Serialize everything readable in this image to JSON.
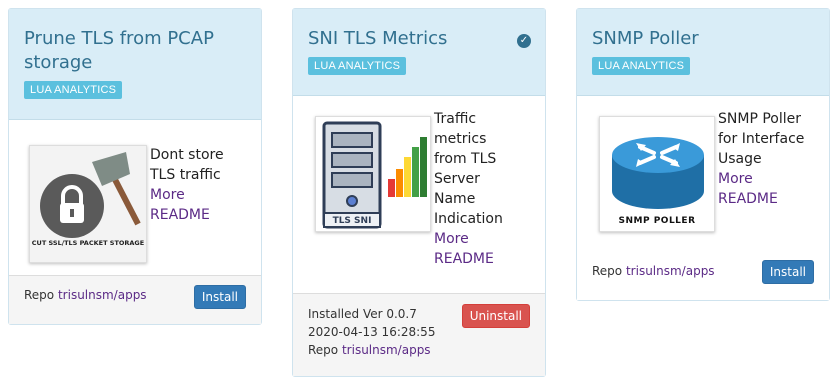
{
  "colors": {
    "header_bg": "#d9edf7",
    "title": "#31708f",
    "badge": "#5bc0de",
    "link": "#5b2a86",
    "install": "#337ab7",
    "uninstall": "#d9534f"
  },
  "cards": [
    {
      "title_line1": "Prune TLS from PCAP",
      "title_line2": "storage",
      "badge": "LUA ANALYTICS",
      "thumb_caption": "CUT SSL/TLS PACKET STORAGE",
      "desc_line1": "Dont store",
      "desc_line2": "TLS traffic",
      "more": "More",
      "readme": "README",
      "repo_label": "Repo",
      "repo_link": "trisulnsm/apps",
      "button": "Install"
    },
    {
      "title": "SNI TLS Metrics",
      "badge": "LUA ANALYTICS",
      "installed_icon": "check-circle-icon",
      "thumb_caption": "TLS SNI",
      "desc_lines": [
        "Traffic",
        "metrics",
        "from TLS",
        "Server",
        "Name",
        "Indication"
      ],
      "more": "More",
      "readme": "README",
      "installed_ver": "Installed Ver 0.0.7",
      "installed_date": "2020-04-13 16:28:55",
      "repo_label": "Repo",
      "repo_link": "trisulnsm/apps",
      "button": "Uninstall"
    },
    {
      "title": "SNMP Poller",
      "badge": "LUA ANALYTICS",
      "thumb_caption": "SNMP POLLER",
      "desc_lines": [
        "SNMP Poller",
        "for Interface",
        "Usage"
      ],
      "more": "More",
      "readme": "README",
      "repo_label": "Repo",
      "repo_link": "trisulnsm/apps",
      "button": "Install"
    }
  ]
}
